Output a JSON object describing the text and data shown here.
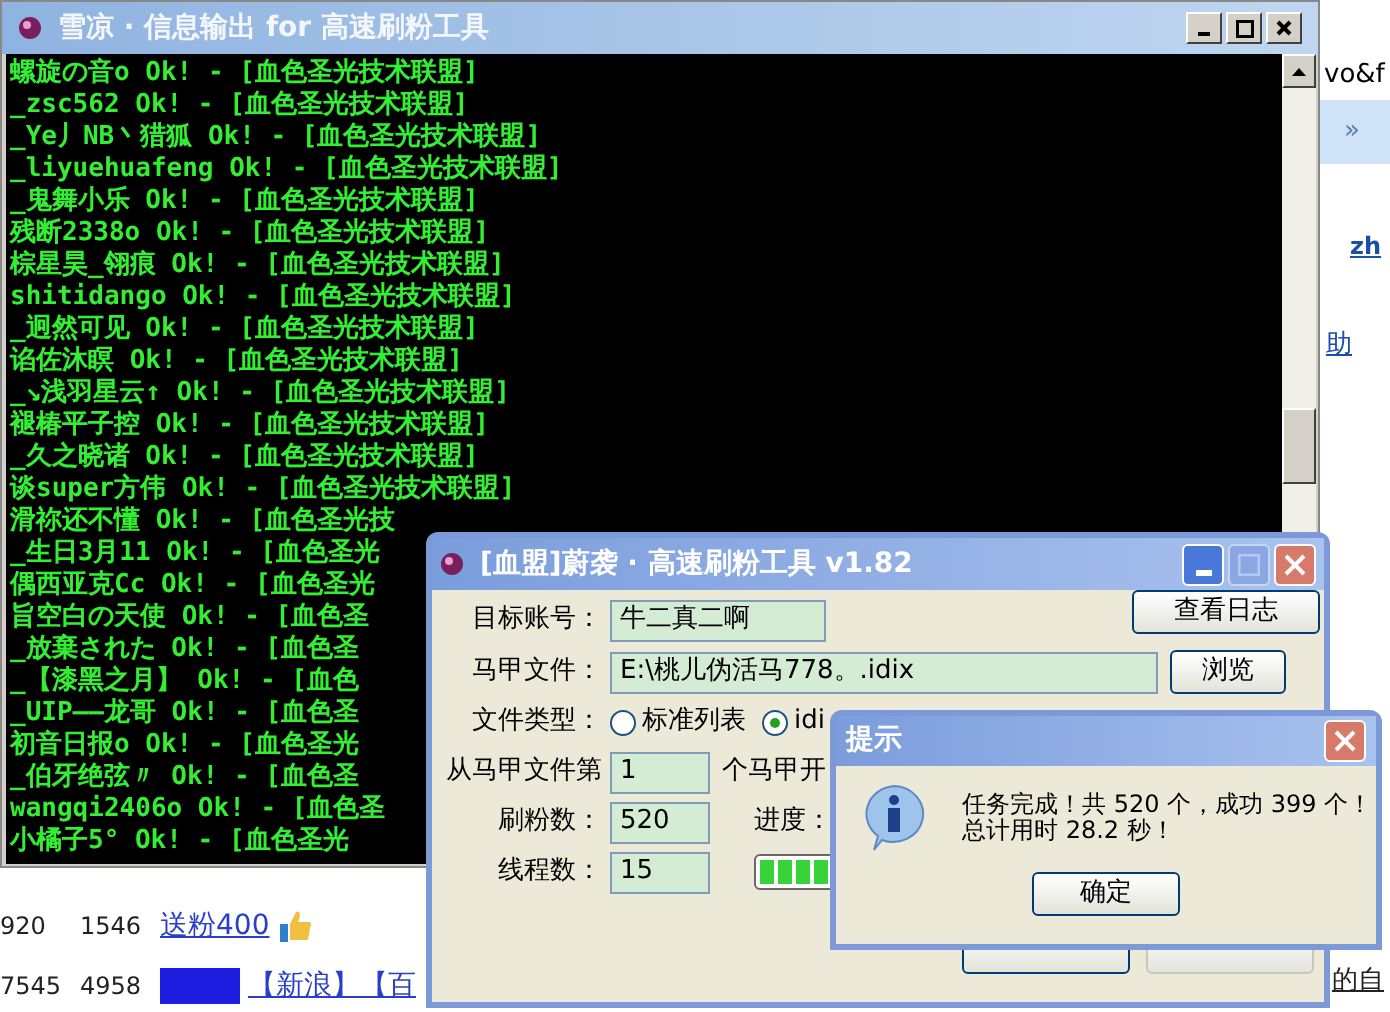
{
  "browser_background": {
    "address_fragment": "vo&f",
    "toolbar_chevron": "»",
    "link_top": "zh",
    "link_mid": "助",
    "rows": [
      {
        "cells": [
          "920",
          "1546"
        ],
        "link": "送粉400",
        "highlight": false
      },
      {
        "cells": [
          "7545",
          "4958"
        ],
        "link": "【新浪】【百",
        "highlight": true
      }
    ],
    "trailing_link": "的自"
  },
  "console_window": {
    "title": "雪凉 · 信息输出 for 高速刷粉工具",
    "lines": [
      "螺旋の音o Ok! - [血色圣光技术联盟]",
      "_zsc562 Ok! - [血色圣光技术联盟]",
      "_Ye丿NB丶猎狐 Ok! - [血色圣光技术联盟]",
      "_liyuehuafeng Ok! - [血色圣光技术联盟]",
      "_鬼舞小乐 Ok! - [血色圣光技术联盟]",
      "残断2338o Ok! - [血色圣光技术联盟]",
      "棕星昊_翎痕 Ok! - [血色圣光技术联盟]",
      "shitidango Ok! - [血色圣光技术联盟]",
      "_迥然可见 Ok! - [血色圣光技术联盟]",
      "谄佐沐瞑 Ok! - [血色圣光技术联盟]",
      "_↘浅羽星云↑ Ok! - [血色圣光技术联盟]",
      "褪椿平子控 Ok! - [血色圣光技术联盟]",
      "_久之晓诸 Ok! - [血色圣光技术联盟]",
      "谈super方伟 Ok! - [血色圣光技术联盟]",
      "滑祢还不懂 Ok! - [血色圣光技",
      "_生日3月11 Ok! - [血色圣光",
      "偶西亚克Cc Ok! - [血色圣光",
      "旨空白の天使 Ok! - [血色圣",
      "_放棄された Ok! - [血色圣",
      "_【漆黑之月】 Ok! - [血色",
      "_UIP——龙哥 Ok! - [血色圣",
      "初音日报o Ok! - [血色圣光",
      "_伯牙绝弦〃 Ok! - [血色圣",
      "wangqi2406o Ok! - [血色圣",
      "小橘子5° Ok! - [血色圣光"
    ]
  },
  "tool_window": {
    "title": "[血盟]蔚袭 · 高速刷粉工具 v1.82",
    "target_account": {
      "label": "目标账号：",
      "value": "牛二真二啊"
    },
    "view_log_button": "查看日志",
    "account_file": {
      "label": "马甲文件：",
      "value": "E:\\桃儿伪活马778。.idix"
    },
    "browse_button": "浏览",
    "file_type": {
      "label": "文件类型：",
      "options": [
        {
          "label": "标准列表",
          "selected": false
        },
        {
          "label": "idi",
          "selected": true
        }
      ]
    },
    "start_from": {
      "label": "从马甲文件第",
      "value": "1",
      "suffix": "个马甲开"
    },
    "fan_count": {
      "label": "刷粉数：",
      "value": "520"
    },
    "progress": {
      "label": "进度：",
      "level": 1
    },
    "threads": {
      "label": "线程数：",
      "value": "15"
    },
    "buttons": [
      {
        "disabled": false
      },
      {
        "disabled": true
      }
    ]
  },
  "message_box": {
    "title": "提示",
    "lines": [
      "任务完成！共 520 个，成功 399 个！",
      "总计用时 28.2 秒！"
    ],
    "button": "确定"
  }
}
